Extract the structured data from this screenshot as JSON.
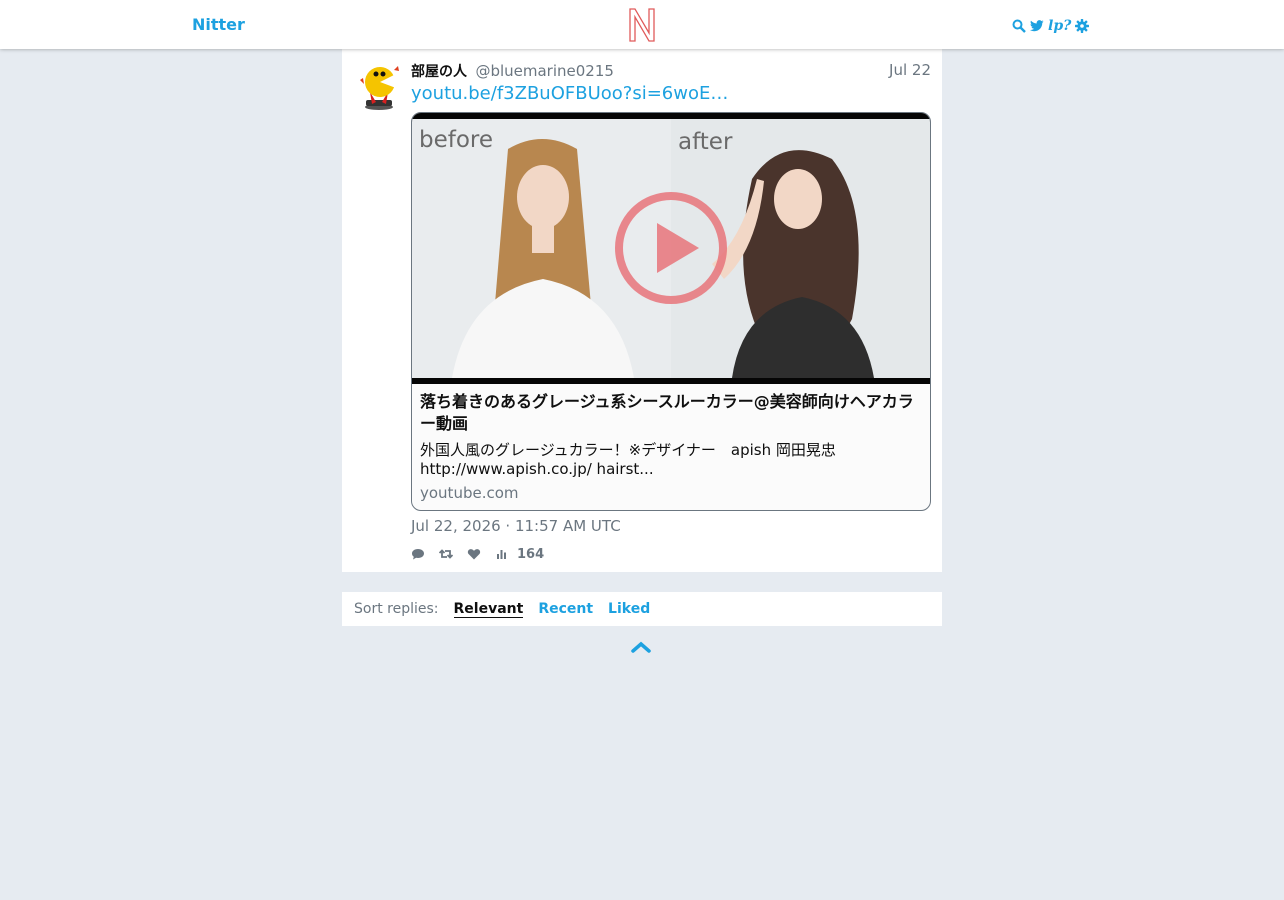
{
  "nav": {
    "brand": "Nitter",
    "logo_letter": "N",
    "lp_label": "lp?"
  },
  "tweet": {
    "fullname": "部屋の人",
    "username": "@bluemarine0215",
    "date": "Jul 22",
    "link_text": "youtu.be/f3ZBuOFBUoo?si=6woE…",
    "card": {
      "image_before_label": "before",
      "image_after_label": "after",
      "title": "落ち着きのあるグレージュ系シースルーカラー@美容師向けヘアカラー動画",
      "description": "外国人風のグレージュカラー！※デザイナー　apish 岡田晃忠 http://www.apish.co.jp/ hairst...",
      "domain": "youtube.com"
    },
    "published": "Jul 22, 2026 · 11:57 AM UTC",
    "stats": {
      "views": "164"
    }
  },
  "sort": {
    "label": "Sort replies:",
    "options": [
      "Relevant",
      "Recent",
      "Liked"
    ]
  },
  "colors": {
    "accent": "#1da1e0",
    "background": "#e6ebf1",
    "muted": "#6b7680"
  },
  "icons": [
    "search-icon",
    "twitter-bird-icon",
    "gear-icon",
    "comment-icon",
    "retweet-icon",
    "heart-icon",
    "views-chart-icon",
    "chevron-up-icon"
  ]
}
